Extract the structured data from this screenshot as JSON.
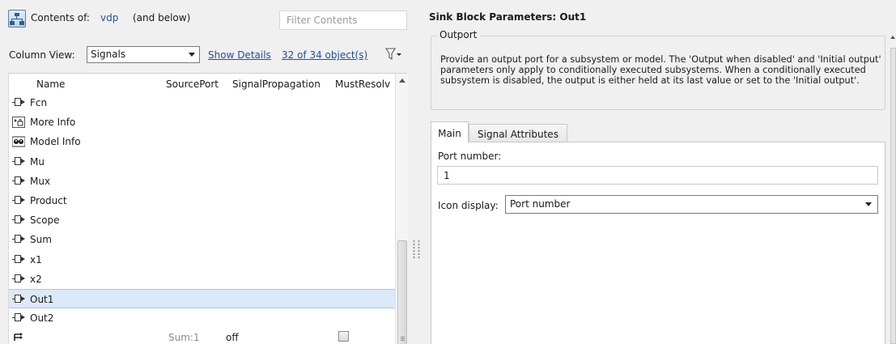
{
  "contents": {
    "label": "Contents of:",
    "model": "vdp",
    "scope": "(and below)",
    "filter_placeholder": "Filter Contents"
  },
  "toolbar": {
    "column_view_label": "Column View:",
    "column_view_value": "Signals",
    "show_details": "Show Details",
    "object_count": "32 of 34 object(s)"
  },
  "table": {
    "columns": [
      "Name",
      "SourcePort",
      "SignalPropagation",
      "MustResolv"
    ],
    "rows": [
      {
        "icon": "port-block-icon",
        "name": "Fcn",
        "source_port": "",
        "propagation": "",
        "selected": false
      },
      {
        "icon": "more-info-icon",
        "name": "More Info",
        "source_port": "",
        "propagation": "",
        "selected": false
      },
      {
        "icon": "model-info-icon",
        "name": "Model Info",
        "source_port": "",
        "propagation": "",
        "selected": false
      },
      {
        "icon": "port-block-icon",
        "name": "Mu",
        "source_port": "",
        "propagation": "",
        "selected": false
      },
      {
        "icon": "port-block-icon",
        "name": "Mux",
        "source_port": "",
        "propagation": "",
        "selected": false
      },
      {
        "icon": "port-block-icon",
        "name": "Product",
        "source_port": "",
        "propagation": "",
        "selected": false
      },
      {
        "icon": "port-block-icon",
        "name": "Scope",
        "source_port": "",
        "propagation": "",
        "selected": false
      },
      {
        "icon": "port-block-icon",
        "name": "Sum",
        "source_port": "",
        "propagation": "",
        "selected": false
      },
      {
        "icon": "port-block-icon",
        "name": "x1",
        "source_port": "",
        "propagation": "",
        "selected": false
      },
      {
        "icon": "port-block-icon",
        "name": "x2",
        "source_port": "",
        "propagation": "",
        "selected": false
      },
      {
        "icon": "port-block-icon",
        "name": "Out1",
        "source_port": "",
        "propagation": "",
        "selected": true
      },
      {
        "icon": "port-block-icon",
        "name": "Out2",
        "source_port": "",
        "propagation": "",
        "selected": false
      },
      {
        "icon": "signal-line-icon",
        "name": "",
        "source_port": "Sum:1",
        "propagation": "off",
        "selected": false,
        "must_resolve": false
      }
    ]
  },
  "params": {
    "title": "Sink Block Parameters: Out1",
    "group": "Outport",
    "description": "Provide an output port for a subsystem or model.  The 'Output when disabled' and 'Initial output' parameters only apply to conditionally executed subsystems. When a conditionally executed subsystem is disabled, the output is either held at its last value or set to the 'Initial output'.",
    "tabs": [
      "Main",
      "Signal Attributes"
    ],
    "port_number_label": "Port number:",
    "port_number_value": "1",
    "icon_display_label": "Icon display:",
    "icon_display_value": "Port number"
  },
  "colors": {
    "link": "#1f4fa0",
    "selection": "#dce9f8"
  }
}
